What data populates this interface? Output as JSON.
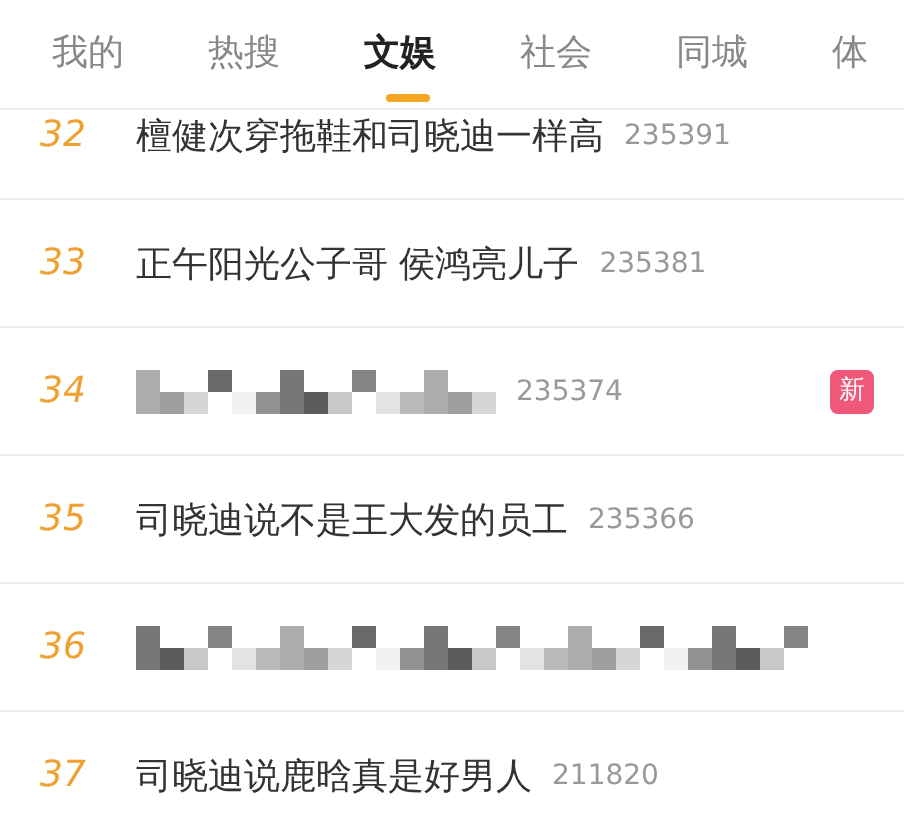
{
  "tabs": [
    {
      "label": "我的",
      "selected": false
    },
    {
      "label": "热搜",
      "selected": false
    },
    {
      "label": "文娱",
      "selected": true
    },
    {
      "label": "社会",
      "selected": false
    },
    {
      "label": "同城",
      "selected": false
    },
    {
      "label": "体",
      "selected": false
    }
  ],
  "rows": [
    {
      "rank": "32",
      "kind": "text",
      "title": "檀健次穿拖鞋和司晓迪一样高",
      "count": "235391"
    },
    {
      "rank": "33",
      "kind": "text",
      "title": "正午阳光公子哥 侯鸿亮儿子",
      "count": "235381"
    },
    {
      "rank": "34",
      "kind": "mosaic",
      "count": "235374",
      "badge": "新"
    },
    {
      "rank": "35",
      "kind": "text",
      "title": "司晓迪说不是王大发的员工",
      "count": "235366"
    },
    {
      "rank": "36",
      "kind": "mosaic"
    },
    {
      "rank": "37",
      "kind": "text",
      "title": "司晓迪说鹿晗真是好男人",
      "count": "211820"
    }
  ]
}
